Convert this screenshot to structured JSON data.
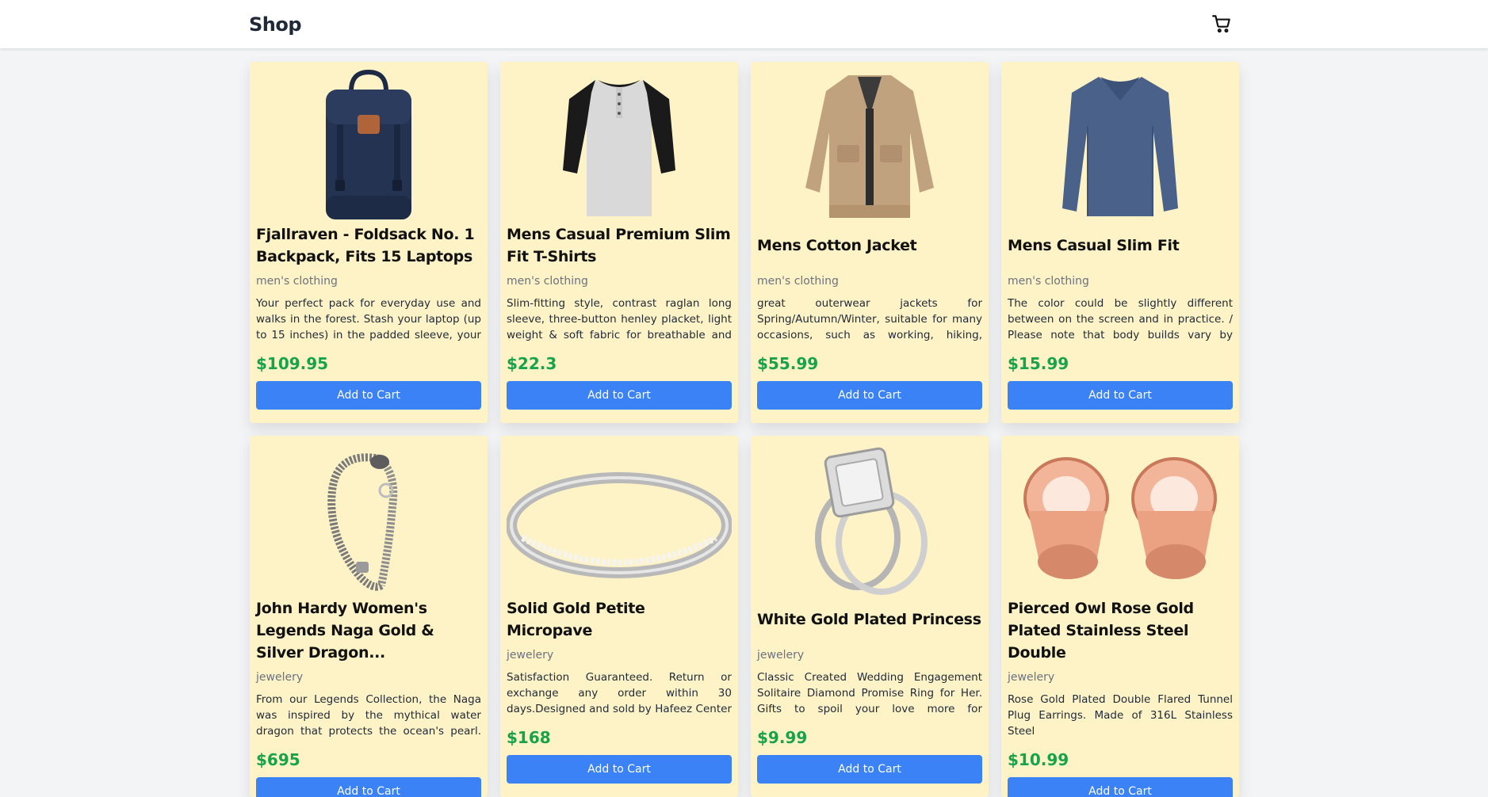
{
  "header": {
    "title": "Shop",
    "cart_icon": "cart-icon"
  },
  "products": [
    {
      "name": "Fjallraven - Foldsack No. 1 Backpack, Fits 15 Laptops",
      "category": "men's clothing",
      "description": "Your perfect pack for everyday use and walks in the forest. Stash your laptop (up to 15 inches) in the padded sleeve, your everyday",
      "price": "$109.95",
      "button": "Add to Cart",
      "image": "backpack"
    },
    {
      "name": "Mens Casual Premium Slim Fit T-Shirts",
      "category": "men's clothing",
      "description": "Slim-fitting style, contrast raglan long sleeve, three-button henley placket, light weight & soft fabric for breathable and comfortab...",
      "price": "$22.3",
      "button": "Add to Cart",
      "image": "henley-shirt"
    },
    {
      "name": "Mens Cotton Jacket",
      "category": "men's clothing",
      "description": "great outerwear jackets for Spring/Autumn/Winter, suitable for many occasions, such as working, hiking, campin...",
      "price": "$55.99",
      "button": "Add to Cart",
      "image": "cotton-jacket"
    },
    {
      "name": "Mens Casual Slim Fit",
      "category": "men's clothing",
      "description": "The color could be slightly different between on the screen and in practice. / Please note that body builds vary by person, therefor...",
      "price": "$15.99",
      "button": "Add to Cart",
      "image": "long-sleeve-shirt"
    },
    {
      "name": "John Hardy Women's Legends Naga Gold & Silver Dragon...",
      "category": "jewelery",
      "description": "From our Legends Collection, the Naga was inspired by the mythical water dragon that protects the ocean's pearl. Wear faci...",
      "price": "$695",
      "button": "Add to Cart",
      "image": "dragon-bracelet"
    },
    {
      "name": "Solid Gold Petite Micropave",
      "category": "jewelery",
      "description": "Satisfaction Guaranteed. Return or exchange any order within 30 days.Designed and sold by Hafeez Center in the United Stat...",
      "price": "$168",
      "button": "Add to Cart",
      "image": "micropave-ring"
    },
    {
      "name": "White Gold Plated Princess",
      "category": "jewelery",
      "description": "Classic Created Wedding Engagement Solitaire Diamond Promise Ring for Her. Gifts to spoil your love more for Engageme...",
      "price": "$9.99",
      "button": "Add to Cart",
      "image": "princess-ring"
    },
    {
      "name": "Pierced Owl Rose Gold Plated Stainless Steel Double",
      "category": "jewelery",
      "description": "Rose Gold Plated Double Flared Tunnel Plug Earrings. Made of 316L Stainless Steel",
      "price": "$10.99",
      "button": "Add to Cart",
      "image": "tunnel-plugs"
    }
  ]
}
